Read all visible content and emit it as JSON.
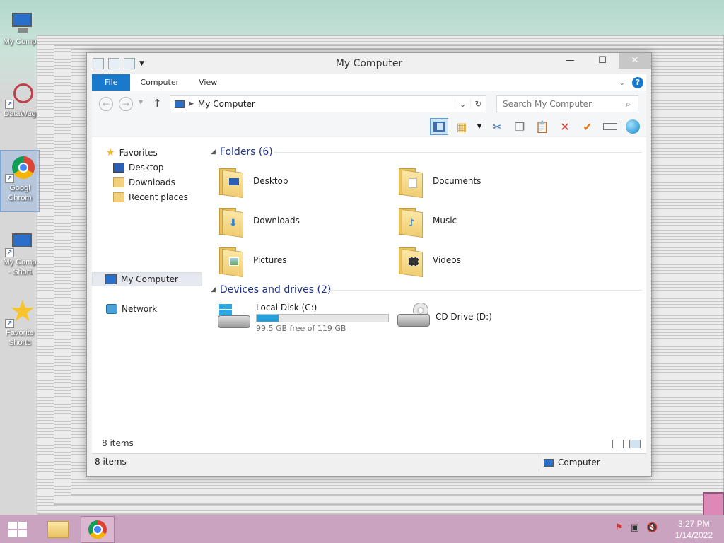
{
  "desktop": {
    "icons": [
      {
        "label": "My Comp",
        "icon": "computer-icon"
      },
      {
        "label": "DataWag",
        "icon": "datawag-icon"
      },
      {
        "label": "Googl Chrom",
        "icon": "chrome-icon"
      },
      {
        "label": "My Comp - Short",
        "icon": "computer-icon"
      },
      {
        "label": "Favorite Shortc",
        "icon": "star-icon"
      }
    ]
  },
  "window": {
    "title": "My Computer",
    "controls": {
      "minimize": "—",
      "maximize": "☐",
      "close": "✕"
    },
    "ribbon": {
      "tabs": [
        "File",
        "Computer",
        "View"
      ],
      "help": "?"
    },
    "address": {
      "back": "←",
      "forward": "→",
      "up": "↑",
      "path": "My Computer",
      "search_placeholder": "Search My Computer"
    },
    "navpane": {
      "favorites": "Favorites",
      "favorites_items": [
        "Desktop",
        "Downloads",
        "Recent places"
      ],
      "this_pc": "My Computer",
      "network": "Network"
    },
    "folders_group": {
      "header": "Folders (6)",
      "items": [
        {
          "name": "Desktop",
          "icon": "desktop-folder-icon"
        },
        {
          "name": "Documents",
          "icon": "documents-folder-icon"
        },
        {
          "name": "Downloads",
          "icon": "downloads-folder-icon"
        },
        {
          "name": "Music",
          "icon": "music-folder-icon"
        },
        {
          "name": "Pictures",
          "icon": "pictures-folder-icon"
        },
        {
          "name": "Videos",
          "icon": "videos-folder-icon"
        }
      ]
    },
    "drives_group": {
      "header": "Devices and drives (2)",
      "items": [
        {
          "name": "Local Disk (C:)",
          "free": "99.5 GB free of 119 GB",
          "used_fraction": 0.164,
          "icon": "hard-disk-icon"
        },
        {
          "name": "CD Drive (D:)",
          "icon": "cd-drive-icon"
        }
      ]
    },
    "item_count": "8 items",
    "status": {
      "left": "8 items",
      "right": "Computer"
    }
  },
  "taskbar": {
    "time": "3:27 PM",
    "date": "1/14/2022",
    "accent": "#c9a3bf"
  }
}
